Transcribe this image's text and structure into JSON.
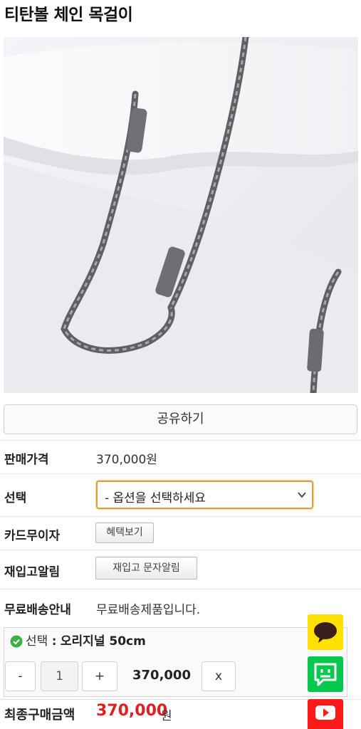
{
  "product": {
    "title": "티탄볼 체인 목걸이",
    "share_label": "공유하기"
  },
  "info": {
    "price_label": "판매가격",
    "price_value": "370,000원",
    "option_label": "선택",
    "option_select_value": "- 옵션을 선택하세요",
    "card_label": "카드무이자",
    "card_button": "혜택보기",
    "restock_label": "재입고알림",
    "restock_button": "재입고 문자알림",
    "shipping_label": "무료배송안내",
    "shipping_value": "무료배송제품입니다."
  },
  "selected_option": {
    "prefix": "선택",
    "separator": ":",
    "value": "오리지널 50cm",
    "minus_label": "-",
    "quantity": "1",
    "plus_label": "+",
    "price": "370,000",
    "remove_label": "x"
  },
  "total": {
    "label": "최종구매금액",
    "price": "370,000",
    "unit": "원"
  },
  "floating": {
    "kakao_icon": "kakao-chat-icon",
    "talk_icon": "talk-chat-icon",
    "youtube_icon": "youtube-play-icon"
  },
  "colors": {
    "accent_red": "#e02020",
    "select_border": "#d8a33a",
    "kakao_yellow": "#ffe100",
    "talk_green": "#07c84e",
    "youtube_red": "#ff1a1a"
  }
}
